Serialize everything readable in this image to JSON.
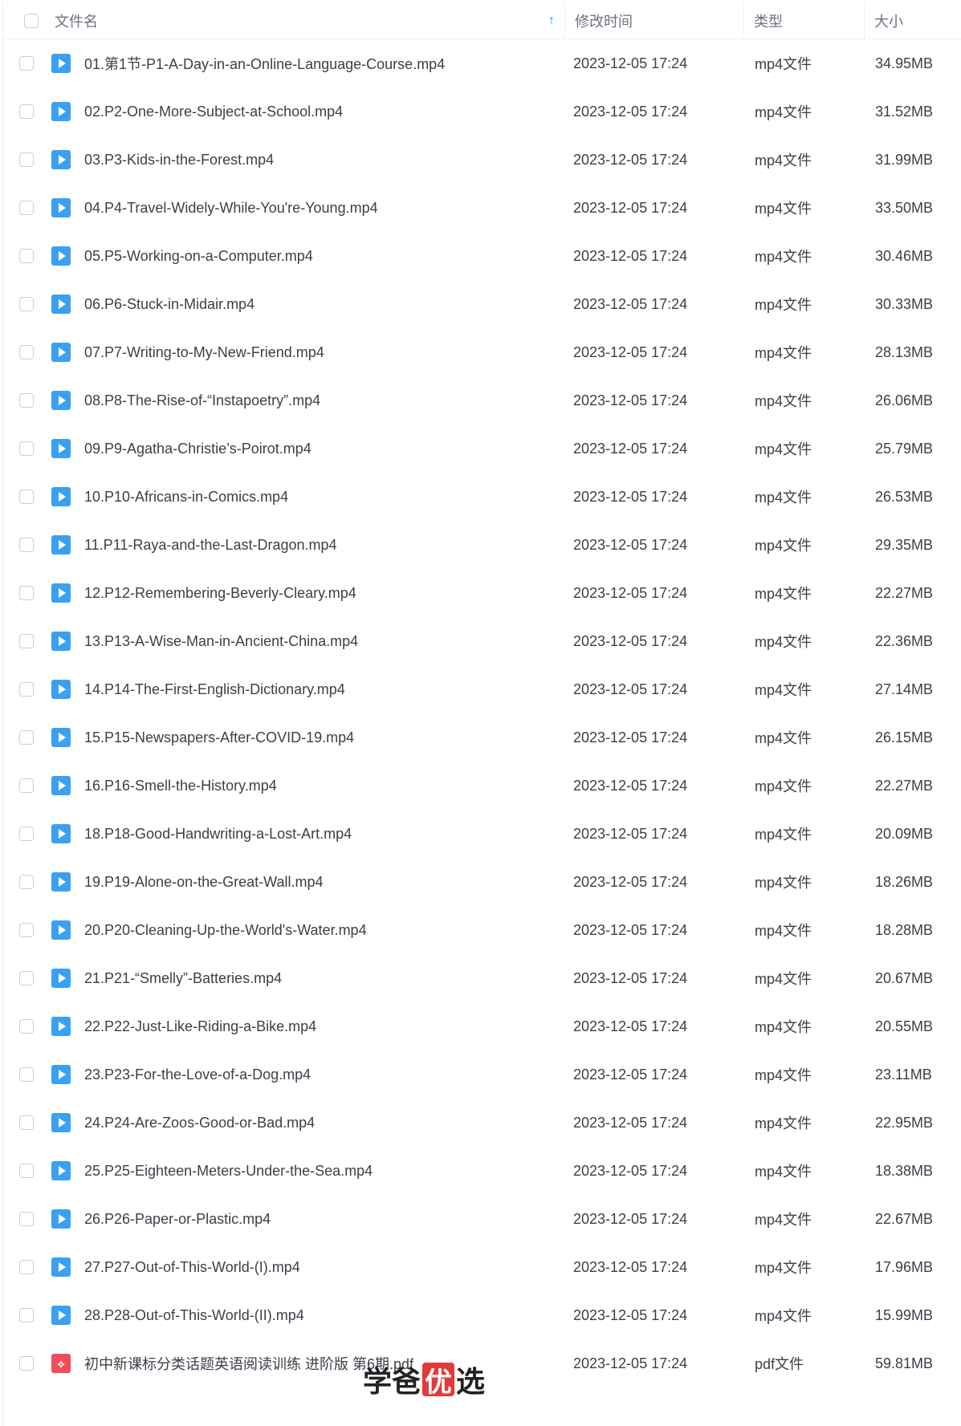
{
  "header": {
    "name": "文件名",
    "modified": "修改时间",
    "type": "类型",
    "size": "大小",
    "sort_arrow": "↑"
  },
  "files": [
    {
      "name": "01.第1节-P1-A-Day-in-an-Online-Language-Course.mp4",
      "time": "2023-12-05 17:24",
      "type": "mp4文件",
      "size": "34.95MB",
      "icon": "video-file-icon"
    },
    {
      "name": "02.P2-One-More-Subject-at-School.mp4",
      "time": "2023-12-05 17:24",
      "type": "mp4文件",
      "size": "31.52MB",
      "icon": "video-file-icon"
    },
    {
      "name": "03.P3-Kids-in-the-Forest.mp4",
      "time": "2023-12-05 17:24",
      "type": "mp4文件",
      "size": "31.99MB",
      "icon": "video-file-icon"
    },
    {
      "name": "04.P4-Travel-Widely-While-You're-Young.mp4",
      "time": "2023-12-05 17:24",
      "type": "mp4文件",
      "size": "33.50MB",
      "icon": "video-file-icon"
    },
    {
      "name": "05.P5-Working-on-a-Computer.mp4",
      "time": "2023-12-05 17:24",
      "type": "mp4文件",
      "size": "30.46MB",
      "icon": "video-file-icon"
    },
    {
      "name": "06.P6-Stuck-in-Midair.mp4",
      "time": "2023-12-05 17:24",
      "type": "mp4文件",
      "size": "30.33MB",
      "icon": "video-file-icon"
    },
    {
      "name": "07.P7-Writing-to-My-New-Friend.mp4",
      "time": "2023-12-05 17:24",
      "type": "mp4文件",
      "size": "28.13MB",
      "icon": "video-file-icon"
    },
    {
      "name": "08.P8-The-Rise-of-“Instapoetry”.mp4",
      "time": "2023-12-05 17:24",
      "type": "mp4文件",
      "size": "26.06MB",
      "icon": "video-file-icon"
    },
    {
      "name": "09.P9-Agatha-Christie’s-Poirot.mp4",
      "time": "2023-12-05 17:24",
      "type": "mp4文件",
      "size": "25.79MB",
      "icon": "video-file-icon"
    },
    {
      "name": "10.P10-Africans-in-Comics.mp4",
      "time": "2023-12-05 17:24",
      "type": "mp4文件",
      "size": "26.53MB",
      "icon": "video-file-icon"
    },
    {
      "name": "11.P11-Raya-and-the-Last-Dragon.mp4",
      "time": "2023-12-05 17:24",
      "type": "mp4文件",
      "size": "29.35MB",
      "icon": "video-file-icon"
    },
    {
      "name": "12.P12-Remembering-Beverly-Cleary.mp4",
      "time": "2023-12-05 17:24",
      "type": "mp4文件",
      "size": "22.27MB",
      "icon": "video-file-icon"
    },
    {
      "name": "13.P13-A-Wise-Man-in-Ancient-China.mp4",
      "time": "2023-12-05 17:24",
      "type": "mp4文件",
      "size": "22.36MB",
      "icon": "video-file-icon"
    },
    {
      "name": "14.P14-The-First-English-Dictionary.mp4",
      "time": "2023-12-05 17:24",
      "type": "mp4文件",
      "size": "27.14MB",
      "icon": "video-file-icon"
    },
    {
      "name": "15.P15-Newspapers-After-COVID-19.mp4",
      "time": "2023-12-05 17:24",
      "type": "mp4文件",
      "size": "26.15MB",
      "icon": "video-file-icon"
    },
    {
      "name": "16.P16-Smell-the-History.mp4",
      "time": "2023-12-05 17:24",
      "type": "mp4文件",
      "size": "22.27MB",
      "icon": "video-file-icon"
    },
    {
      "name": "18.P18-Good-Handwriting-a-Lost-Art.mp4",
      "time": "2023-12-05 17:24",
      "type": "mp4文件",
      "size": "20.09MB",
      "icon": "video-file-icon"
    },
    {
      "name": "19.P19-Alone-on-the-Great-Wall.mp4",
      "time": "2023-12-05 17:24",
      "type": "mp4文件",
      "size": "18.26MB",
      "icon": "video-file-icon"
    },
    {
      "name": "20.P20-Cleaning-Up-the-World's-Water.mp4",
      "time": "2023-12-05 17:24",
      "type": "mp4文件",
      "size": "18.28MB",
      "icon": "video-file-icon"
    },
    {
      "name": "21.P21-“Smelly”-Batteries.mp4",
      "time": "2023-12-05 17:24",
      "type": "mp4文件",
      "size": "20.67MB",
      "icon": "video-file-icon"
    },
    {
      "name": "22.P22-Just-Like-Riding-a-Bike.mp4",
      "time": "2023-12-05 17:24",
      "type": "mp4文件",
      "size": "20.55MB",
      "icon": "video-file-icon"
    },
    {
      "name": "23.P23-For-the-Love-of-a-Dog.mp4",
      "time": "2023-12-05 17:24",
      "type": "mp4文件",
      "size": "23.11MB",
      "icon": "video-file-icon"
    },
    {
      "name": "24.P24-Are-Zoos-Good-or-Bad.mp4",
      "time": "2023-12-05 17:24",
      "type": "mp4文件",
      "size": "22.95MB",
      "icon": "video-file-icon"
    },
    {
      "name": "25.P25-Eighteen-Meters-Under-the-Sea.mp4",
      "time": "2023-12-05 17:24",
      "type": "mp4文件",
      "size": "18.38MB",
      "icon": "video-file-icon"
    },
    {
      "name": "26.P26-Paper-or-Plastic.mp4",
      "time": "2023-12-05 17:24",
      "type": "mp4文件",
      "size": "22.67MB",
      "icon": "video-file-icon"
    },
    {
      "name": "27.P27-Out-of-This-World-(I).mp4",
      "time": "2023-12-05 17:24",
      "type": "mp4文件",
      "size": "17.96MB",
      "icon": "video-file-icon"
    },
    {
      "name": "28.P28-Out-of-This-World-(II).mp4",
      "time": "2023-12-05 17:24",
      "type": "mp4文件",
      "size": "15.99MB",
      "icon": "video-file-icon"
    },
    {
      "name": "初中新课标分类话题英语阅读训练 进阶版 第6期.pdf",
      "time": "2023-12-05 17:24",
      "type": "pdf文件",
      "size": "59.81MB",
      "icon": "pdf-file-icon"
    }
  ],
  "watermark": {
    "pre": "学爸",
    "badge": "优",
    "post": "选"
  },
  "colors": {
    "accent": "#1e90ff",
    "video_icon": "#3aa0f2",
    "pdf_icon": "#f04c5a",
    "watermark_badge": "#e23a3a"
  }
}
